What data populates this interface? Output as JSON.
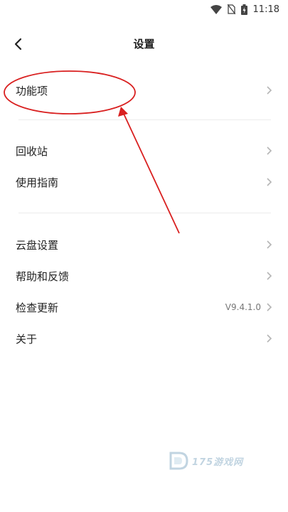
{
  "status_bar": {
    "time": "11:18",
    "icons": [
      "wifi-icon",
      "no-sim-icon",
      "battery-charging-icon"
    ]
  },
  "header": {
    "title": "设置",
    "back_icon": "chevron-left-icon"
  },
  "settings": {
    "group1": [
      {
        "label": "功能项",
        "value": ""
      }
    ],
    "group2": [
      {
        "label": "回收站",
        "value": ""
      },
      {
        "label": "使用指南",
        "value": ""
      }
    ],
    "group3": [
      {
        "label": "云盘设置",
        "value": ""
      },
      {
        "label": "帮助和反馈",
        "value": ""
      },
      {
        "label": "检查更新",
        "value": "V9.4.1.0"
      },
      {
        "label": "关于",
        "value": ""
      }
    ]
  },
  "annotation": {
    "color": "#d92020"
  },
  "watermark": {
    "text": "175游戏网"
  },
  "colors": {
    "text": "#222222",
    "secondary_text": "#777777",
    "chevron": "#b5b5b5",
    "divider": "#ececec"
  }
}
